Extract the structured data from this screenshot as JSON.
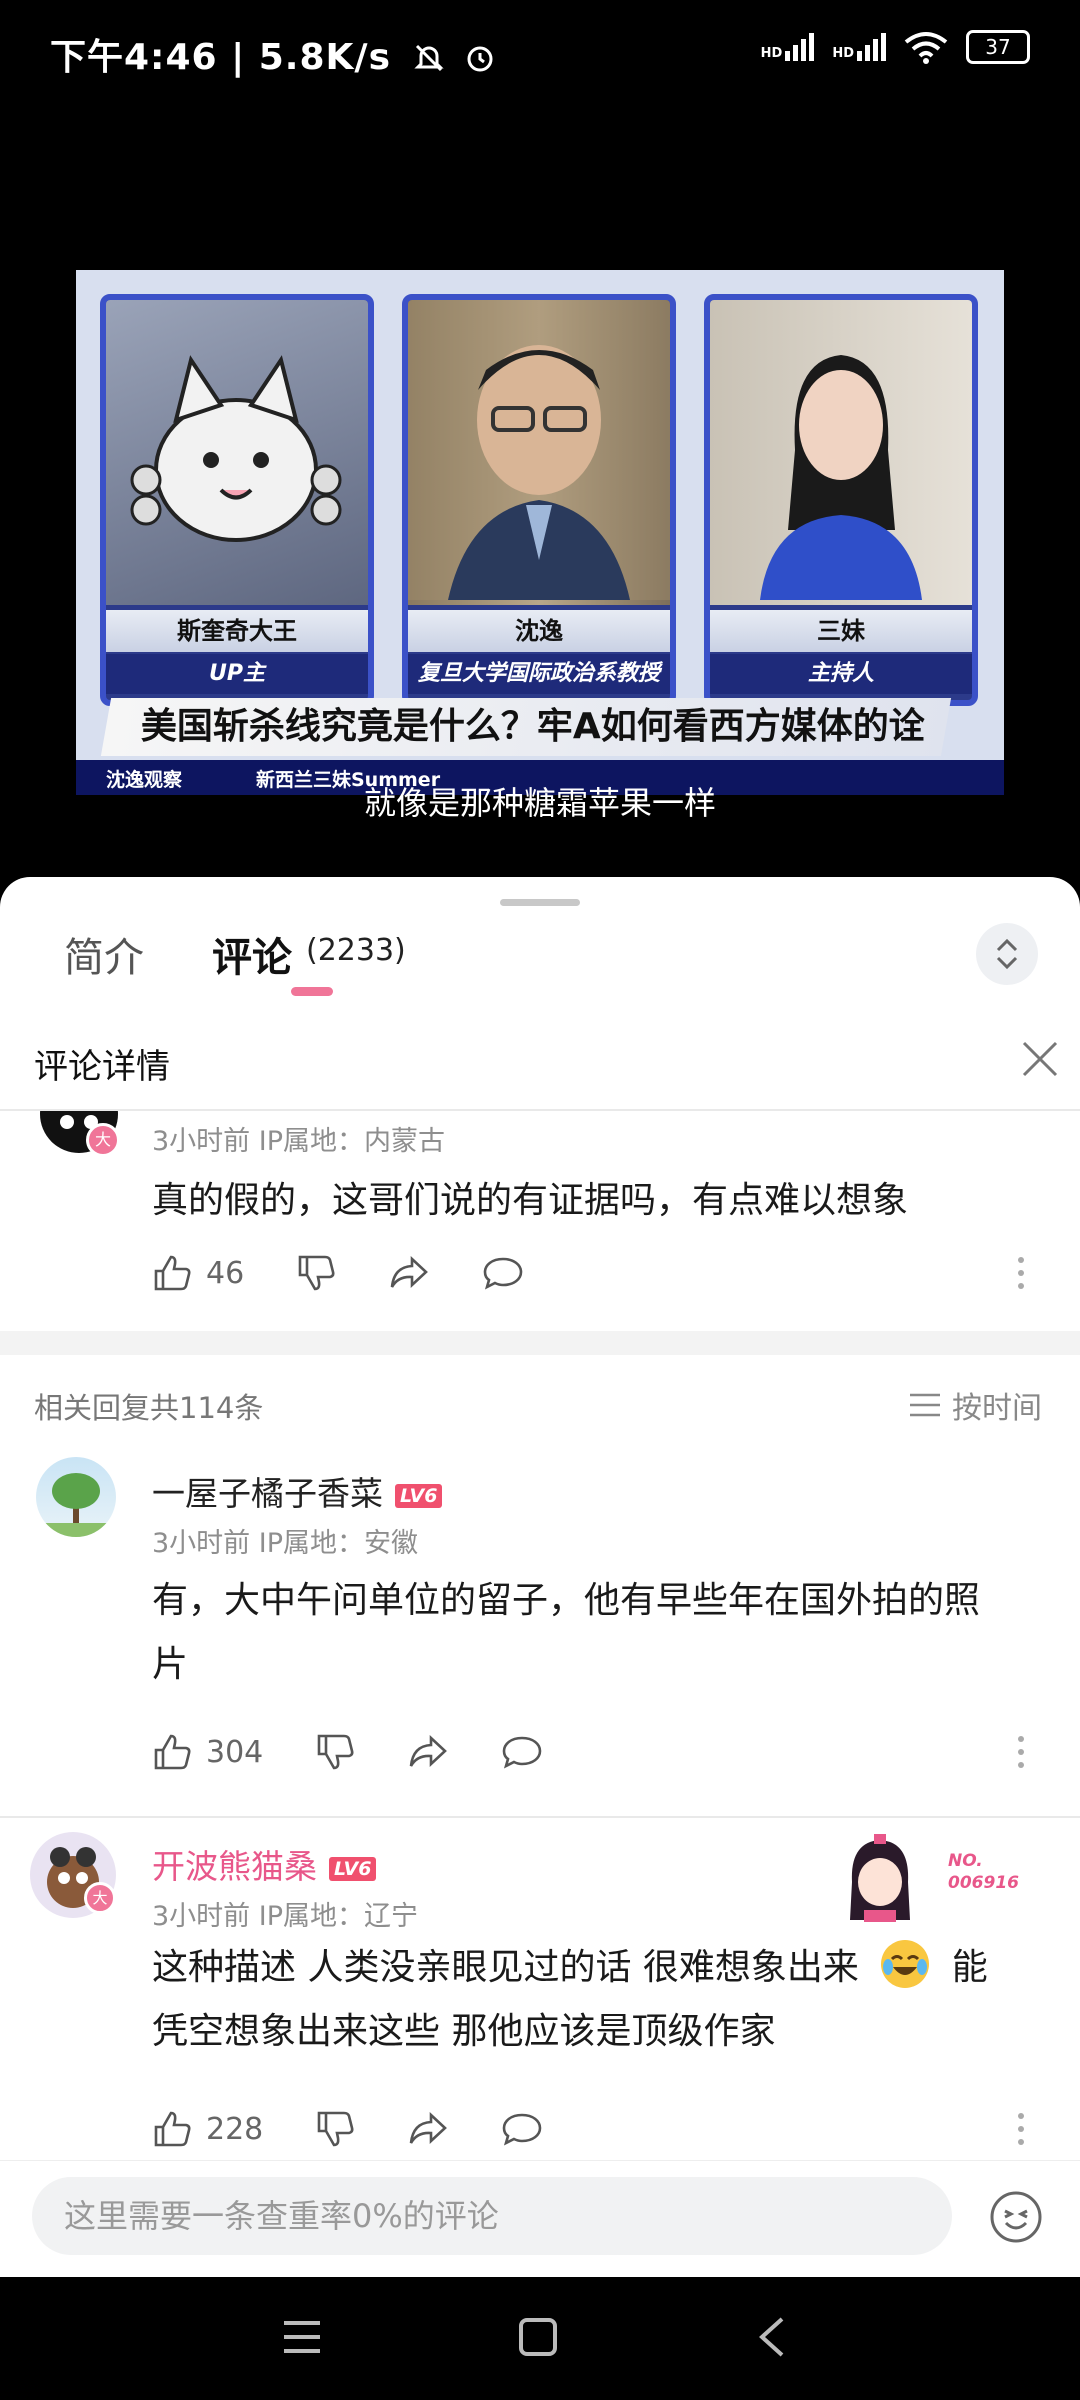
{
  "status_bar": {
    "time": "下午4:46 | 5.8K/s",
    "network_1": "HD",
    "network_2": "HD",
    "battery": "37"
  },
  "video": {
    "panels": [
      {
        "name": "斯奎奇大王",
        "role": "UP主"
      },
      {
        "name": "沈逸",
        "role": "复旦大学国际政治系教授"
      },
      {
        "name": "三妹",
        "role": "主持人"
      }
    ],
    "headline": "美国斩杀线究竟是什么？牢A如何看西方媒体的诠释",
    "tag_left": "沈逸观察",
    "tag_right": "新西兰三妹Summer",
    "subtitle": "就像是那种糖霜苹果一样"
  },
  "tabs": {
    "intro": "简介",
    "comments": "评论",
    "comments_count": "(2233)"
  },
  "detail": {
    "title": "评论详情",
    "main_comment": {
      "meta": "3小时前 IP属地：内蒙古",
      "text": "真的假的，这哥们说的有证据吗，有点难以想象",
      "likes": "46"
    },
    "replies_header": "相关回复共114条",
    "sort_label": "按时间",
    "replies": [
      {
        "username": "一屋子橘子香菜",
        "level": "LV6",
        "meta": "3小时前 IP属地：安徽",
        "text_line1": "有，大中午问单位的留子，他有早些年在国外拍的照",
        "text_line2": "片",
        "likes": "304"
      },
      {
        "username": "开波熊猫桑",
        "level": "LV6",
        "meta": "3小时前 IP属地：辽宁",
        "badge_no": "NO.\n006916",
        "text_line1": "这种描述 人类没亲眼见过的话 很难想象出来",
        "text_line1b": "能",
        "text_line2": "凭空想象出来这些 那他应该是顶级作家",
        "likes": "228"
      }
    ]
  },
  "input": {
    "placeholder": "这里需要一条查重率0%的评论"
  },
  "colors": {
    "accent_pink": "#f07598",
    "vip_name": "#e8578a",
    "level_badge": "#f0506e"
  }
}
